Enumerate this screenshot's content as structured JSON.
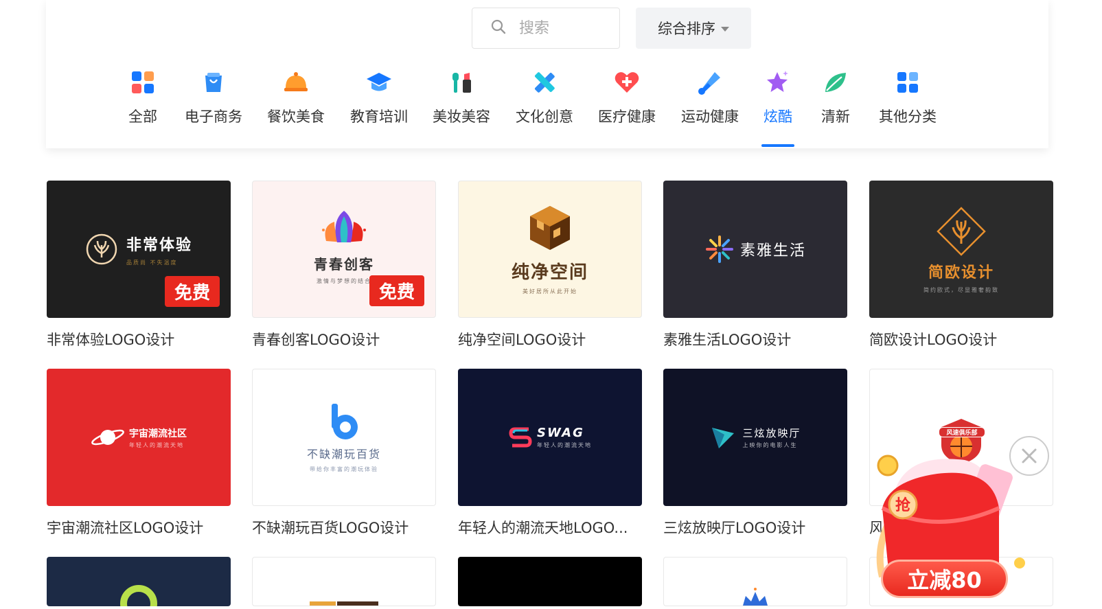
{
  "search": {
    "placeholder": "搜索",
    "value": ""
  },
  "sort": {
    "label": "综合排序"
  },
  "categories": [
    {
      "label": "全部",
      "icon": "grid-icon"
    },
    {
      "label": "电子商务",
      "icon": "shopping-bag-icon"
    },
    {
      "label": "餐饮美食",
      "icon": "food-cloche-icon"
    },
    {
      "label": "教育培训",
      "icon": "graduation-cap-icon"
    },
    {
      "label": "美妆美容",
      "icon": "lipstick-icon"
    },
    {
      "label": "文化创意",
      "icon": "pencil-ruler-icon"
    },
    {
      "label": "医疗健康",
      "icon": "heart-plus-icon"
    },
    {
      "label": "运动健康",
      "icon": "shuttlecock-icon"
    },
    {
      "label": "炫酷",
      "icon": "star-sparkle-icon",
      "active": true
    },
    {
      "label": "清新",
      "icon": "leaf-icon"
    },
    {
      "label": "其他分类",
      "icon": "grid-icon"
    }
  ],
  "cards": [
    {
      "title": "非常体验LOGO设计",
      "logo": "非常体验",
      "sub": "品质尚 不失温度",
      "free": "免费",
      "bg": "#1f1f1f",
      "fg": "#ffffff"
    },
    {
      "title": "青春创客LOGO设计",
      "logo": "青春创客",
      "sub": "激情与梦想的结合",
      "free": "免费",
      "bg": "#fdf2f1",
      "fg": "#333333"
    },
    {
      "title": "纯净空间LOGO设计",
      "logo": "纯净空间",
      "sub": "美好居所从此开始",
      "bg": "#fdf6e3",
      "fg": "#5a3b1e"
    },
    {
      "title": "素雅生活LOGO设计",
      "logo": "素雅生活",
      "bg": "#2b2a33",
      "fg": "#ffffff"
    },
    {
      "title": "简欧设计LOGO设计",
      "logo": "简欧设计",
      "sub": "简约欧式，尽显雅奢韵致",
      "bg": "#2b2b2b",
      "fg": "#e8902e"
    },
    {
      "title": "宇宙潮流社区LOGO设计",
      "logo": "宇宙潮流社区",
      "sub": "年轻人的潮流天地",
      "bg": "#e3292b",
      "fg": "#ffffff"
    },
    {
      "title": "不缺潮玩百货LOGO设计",
      "logo": "不缺潮玩百货",
      "sub": "带给你丰富的潮玩体验",
      "bg": "#ffffff",
      "fg": "#5a6b8c"
    },
    {
      "title": "年轻人的潮流天地LOGO...",
      "logo": "SWAG",
      "sub": "年轻人的潮流天地",
      "bg": "#0e1431",
      "fg": "#ffffff"
    },
    {
      "title": "三炫放映厅LOGO设计",
      "logo": "三炫放映厅",
      "sub": "上映你的电影人生",
      "bg": "#0f1226",
      "fg": "#ffffff"
    },
    {
      "title": "风",
      "logo": "风速俱乐部",
      "bg": "#ffffff",
      "fg": "#d93030"
    }
  ],
  "promo": {
    "badge": "立减80",
    "grab": "抢"
  },
  "colors": {
    "accent": "#1677ff",
    "free_badge": "#e8291f"
  }
}
